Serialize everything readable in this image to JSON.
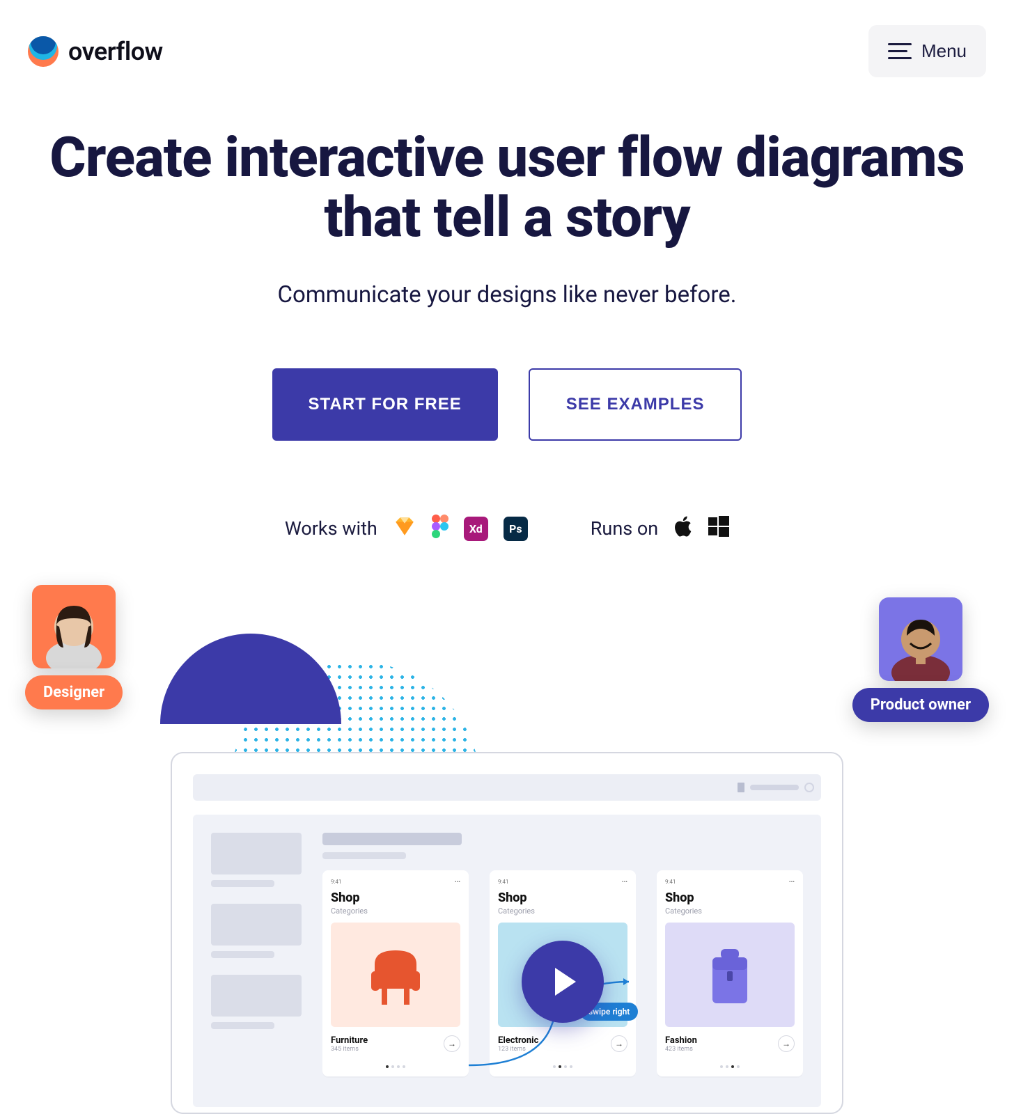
{
  "brand": {
    "name": "overflow"
  },
  "nav": {
    "menu_label": "Menu"
  },
  "hero": {
    "headline": "Create interactive user flow diagrams that tell a story",
    "subheadline": "Communicate your designs like never before.",
    "cta_primary": "START FOR FREE",
    "cta_secondary": "SEE EXAMPLES"
  },
  "integrations": {
    "works_with_label": "Works with",
    "runs_on_label": "Runs on",
    "xd_label": "Xd",
    "ps_label": "Ps"
  },
  "personas": {
    "designer": "Designer",
    "product_owner": "Product owner"
  },
  "mock": {
    "card_time": "9:41",
    "title": "Shop",
    "categories": "Categories",
    "cards": [
      {
        "product": "Furniture",
        "items": "345 items"
      },
      {
        "product": "Electronic",
        "items": "123 items"
      },
      {
        "product": "Fashion",
        "items": "423 items"
      }
    ],
    "swipe_label": "swipe right"
  }
}
